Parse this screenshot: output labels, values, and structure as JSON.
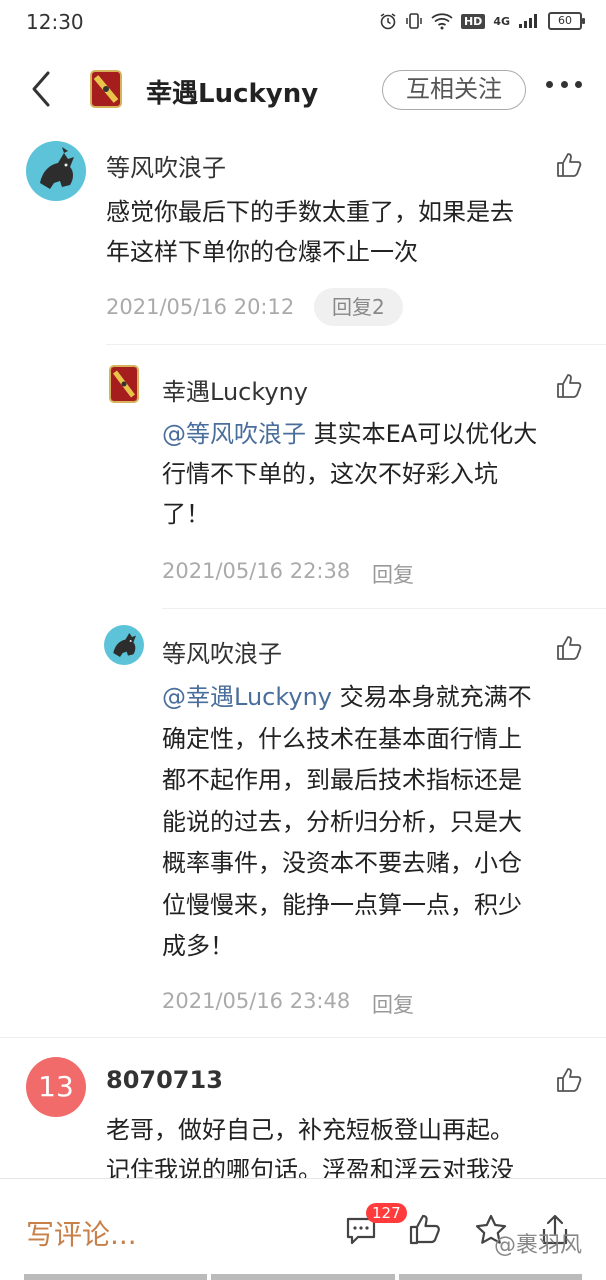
{
  "status_bar": {
    "time": "12:30",
    "hd_label": "HD",
    "network_label": "4G",
    "battery_level": "60"
  },
  "header": {
    "title": "幸遇Luckyny",
    "follow_label": "互相关注"
  },
  "comments": [
    {
      "username": "等风吹浪子",
      "text": "感觉你最后下的手数太重了，如果是去年这样下单你的仓爆不止一次",
      "line1": "感觉你最后下的手数太重了，如果是去",
      "line2": "年这样下单你的仓爆不止一次",
      "time": "2021/05/16 20:12",
      "reply_label": "回复2"
    },
    {
      "username": "8070713",
      "avatar_text": "13",
      "line1": "老哥，做好自己，补充短板登山再起。",
      "line2": "记住我说的哪句话。浮盈和浮云对我没"
    }
  ],
  "replies": [
    {
      "username": "幸遇Luckyny",
      "mention": "@等风吹浪子",
      "line1_rest": " 其实本EA可以优化大",
      "line2": "行情不下单的，这次不好彩入坑",
      "line3": "了！",
      "time": "2021/05/16 22:38",
      "reply_label": "回复"
    },
    {
      "username": "等风吹浪子",
      "mention": "@幸遇Luckyny",
      "line1_rest": " 交易本身就充满不",
      "line2": "确定性，什么技术在基本面行情上",
      "line3": "都不起作用，到最后技术指标还是",
      "line4": "能说的过去，分析归分析，只是大",
      "line5": "概率事件，没资本不要去赌，小仓",
      "line6": "位慢慢来，能挣一点算一点，积少",
      "line7": "成多！",
      "time": "2021/05/16 23:48",
      "reply_label": "回复"
    }
  ],
  "bottom_bar": {
    "write_comment": "写评论...",
    "comment_count": "127",
    "watermark": "@裹羽风"
  },
  "colors": {
    "accent": "#c8804a",
    "mention": "#4a6e9c",
    "badge": "#ff3b3b",
    "number_avatar": "#f26b6b"
  }
}
